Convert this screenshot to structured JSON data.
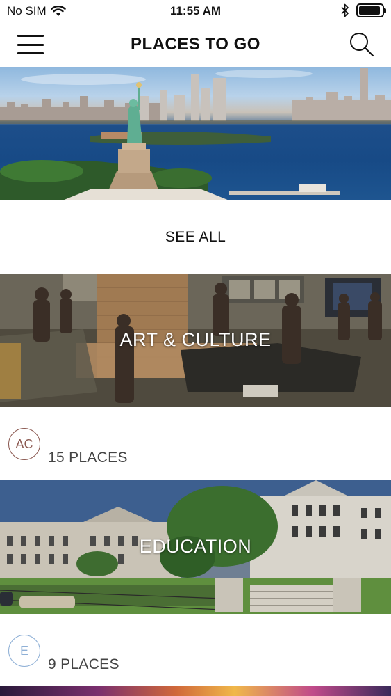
{
  "status_bar": {
    "carrier": "No SIM",
    "time": "11:55 AM",
    "battery_level": 0.95
  },
  "header": {
    "title": "PLACES TO GO"
  },
  "icons": {
    "menu": "hamburger-menu-icon",
    "search": "search-icon",
    "wifi": "wifi-icon",
    "bluetooth": "bluetooth-icon",
    "battery": "battery-icon"
  },
  "see_all": {
    "label": "SEE ALL"
  },
  "categories": [
    {
      "title": "ART & CULTURE",
      "badge": "AC",
      "badge_color": "#8c5a52",
      "count": "15 PLACES"
    },
    {
      "title": "EDUCATION",
      "badge": "E",
      "badge_color": "#8fb0d6",
      "count": "9 PLACES"
    }
  ]
}
